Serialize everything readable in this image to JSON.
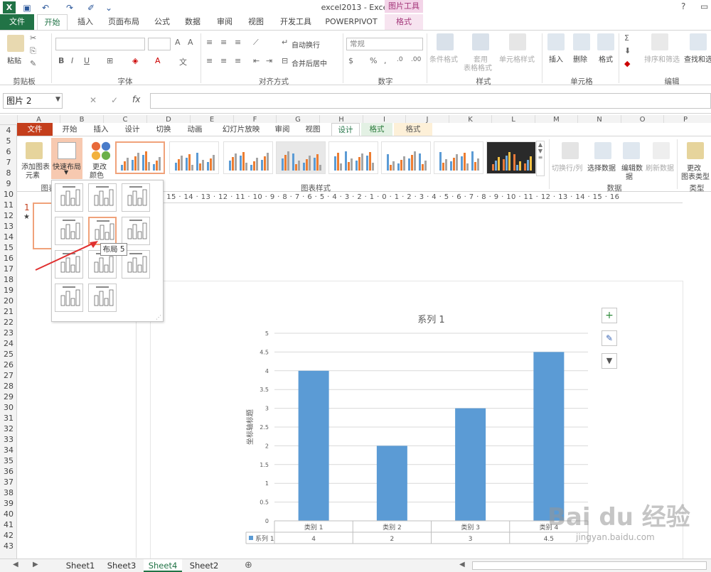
{
  "window": {
    "title": "excel2013 - Excel",
    "app_logo": "X",
    "contextual_group": "图片工具"
  },
  "tabs": [
    "文件",
    "开始",
    "插入",
    "页面布局",
    "公式",
    "数据",
    "审阅",
    "视图",
    "开发工具",
    "POWERPIVOT",
    "格式"
  ],
  "ribbon": {
    "paste": "粘贴",
    "clipboard": "剪贴板",
    "font": "字体",
    "alignment": "对齐方式",
    "wrap": "自动换行",
    "merge": "合并后居中",
    "number_format": "常规",
    "number": "数字",
    "conditional": "条件格式",
    "table_format1": "套用",
    "table_format2": "表格格式",
    "cell_style": "单元格样式",
    "styles": "样式",
    "insert": "插入",
    "delete": "删除",
    "format": "格式",
    "cells": "单元格",
    "sort": "排序和筛选",
    "find": "查找和选择",
    "editing": "编辑"
  },
  "formula_bar": {
    "name_box": "图片 2",
    "fx": "fx",
    "cancel": "✕",
    "enter": "✓"
  },
  "columns": [
    "A",
    "B",
    "C",
    "D",
    "E",
    "F",
    "G",
    "H",
    "I",
    "J",
    "K",
    "L",
    "M",
    "N",
    "O",
    "P"
  ],
  "rows": [
    "4",
    "5",
    "6",
    "7",
    "8",
    "9",
    "10",
    "11",
    "12",
    "13",
    "14",
    "15",
    "16",
    "17",
    "18",
    "19",
    "20",
    "21",
    "22",
    "23",
    "24",
    "25",
    "26",
    "27",
    "28",
    "29",
    "30",
    "31",
    "32",
    "33",
    "34",
    "35",
    "36",
    "37",
    "38",
    "39",
    "40",
    "41",
    "42",
    "43"
  ],
  "ppt": {
    "tabs": [
      "文件",
      "开始",
      "插入",
      "设计",
      "切换",
      "动画",
      "幻灯片放映",
      "审阅",
      "视图",
      "设计",
      "格式",
      "格式"
    ],
    "add_element1": "添加图表",
    "add_element2": "元素",
    "quick_layout": "快速布局",
    "change_colors1": "更改",
    "change_colors2": "颜色",
    "chart_layouts_label": "图表",
    "chart_styles_label": "图表样式",
    "switch_row_col": "切换行/列",
    "select_data": "选择数据",
    "edit_data1": "编辑数",
    "edit_data2": "据",
    "refresh_data": "刷新数据",
    "data_label": "数据",
    "change_type1": "更改",
    "change_type2": "图表类型",
    "type_label": "类型",
    "slide_number": "1",
    "slide_star": "★",
    "ruler_text": "16 · 15 · 14 · 13 · 12 · 11 · 10 · 9 · 8 · 7 · 6 · 5 · 4 · 3 · 2 · 1 · 0 · 1 · 2 · 3 · 4 · 5 · 6 · 7 · 8 · 9 · 10 · 11 · 12 · 13 · 14 · 15 · 16",
    "tooltip": "布局 5"
  },
  "chart_data": {
    "type": "bar",
    "title": "系列 1",
    "ylabel": "坐标轴标题",
    "xlabel": "",
    "categories": [
      "类别 1",
      "类别 2",
      "类别 3",
      "类别 4"
    ],
    "series": [
      {
        "name": "系列 1",
        "values": [
          4,
          2,
          3,
          4.5
        ]
      }
    ],
    "ylim": [
      0,
      5
    ],
    "yticks": [
      "0",
      "0.5",
      "1",
      "1.5",
      "2",
      "2.5",
      "3",
      "3.5",
      "4",
      "4.5",
      "5"
    ],
    "table_values": [
      "4",
      "2",
      "3",
      "4.5"
    ],
    "bar_color": "#5b9bd5",
    "grid": true,
    "legend": "data-table"
  },
  "chart_buttons": [
    "+",
    "✎",
    "▼"
  ],
  "sheets": [
    "Sheet1",
    "Sheet3",
    "Sheet4",
    "Sheet2"
  ],
  "active_sheet": "Sheet4",
  "colors": {
    "excel_green": "#217346",
    "ppt_orange": "#c43e1c",
    "highlight": "#f0a27a",
    "bar": "#5b9bd5",
    "arrow": "#e03030"
  },
  "watermark": "Bai du 经验",
  "watermark_url": "jingyan.baidu.com"
}
